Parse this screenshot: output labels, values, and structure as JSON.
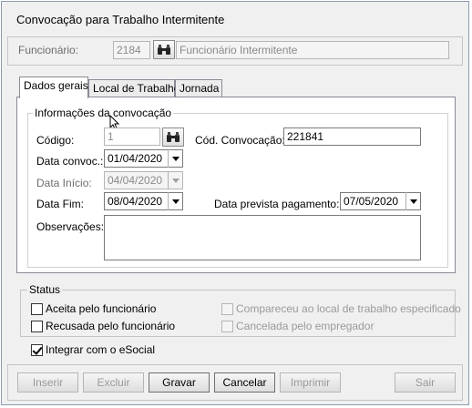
{
  "window": {
    "title": "Convocação para Trabalho Intermitente"
  },
  "funcionario": {
    "label": "Funcionário:",
    "code": "2184",
    "name": "Funcionário Intermitente"
  },
  "tabs": [
    {
      "label": "Dados gerais"
    },
    {
      "label": "Local de Trabalho"
    },
    {
      "label": "Jornada"
    }
  ],
  "convocacao": {
    "group_title": "Informações da convocação",
    "codigo_label": "Código:",
    "codigo_value": "1",
    "cod_convocacao_label": "Cód. Convocação:",
    "cod_convocacao_value": "221841",
    "data_convoc_label": "Data convoc.:",
    "data_convoc_value": "01/04/2020",
    "data_inicio_label": "Data Início:",
    "data_inicio_value": "04/04/2020",
    "data_fim_label": "Data Fim:",
    "data_fim_value": "08/04/2020",
    "data_prevista_label": "Data prevista  pagamento:",
    "data_prevista_value": "07/05/2020",
    "observacoes_label": "Observações:",
    "observacoes_value": ""
  },
  "status": {
    "title": "Status",
    "aceita": "Aceita pelo funcionário",
    "recusada": "Recusada pelo funcionário",
    "compareceu": "Compareceu ao local de trabalho especificado",
    "cancelada": "Cancelada pelo empregador"
  },
  "integrar": {
    "label": "Integrar com o eSocial",
    "checked": true
  },
  "buttons": {
    "inserir": "Inserir",
    "excluir": "Excluir",
    "gravar": "Gravar",
    "cancelar": "Cancelar",
    "imprimir": "Imprimir",
    "sair": "Sair"
  },
  "icons": {
    "lookup": "binoculars-icon",
    "dropdown": "chevron-down-icon",
    "cursor": "mouse-pointer-icon"
  }
}
